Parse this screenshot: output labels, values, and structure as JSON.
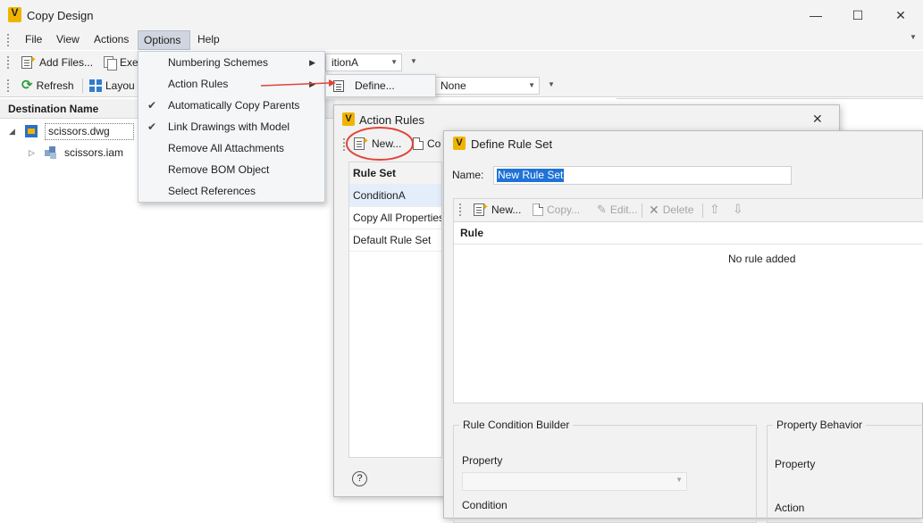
{
  "window": {
    "title": "Copy Design",
    "app_icon_letter": "V",
    "controls": {
      "minimize": "—",
      "maximize": "☐",
      "close": "✕"
    }
  },
  "menubar": {
    "items": [
      "File",
      "View",
      "Actions",
      "Options",
      "Help"
    ],
    "active": "Options"
  },
  "toolbar1": {
    "add_files": "Add Files...",
    "execute_partial": "Exe",
    "combo_value": "itionA"
  },
  "toolbar2": {
    "refresh": "Refresh",
    "layout_partial": "Layou",
    "combo_value": "None"
  },
  "tree": {
    "header": "Destination Name",
    "rows": [
      {
        "label": "scissors.dwg",
        "expanded": true
      },
      {
        "label": "scissors.iam",
        "expanded": false
      }
    ]
  },
  "options_menu": {
    "items": [
      {
        "label": "Numbering Schemes",
        "checked": false,
        "submenu": true
      },
      {
        "label": "Action Rules",
        "checked": false,
        "submenu": true
      },
      {
        "label": "Automatically Copy Parents",
        "checked": true,
        "submenu": false
      },
      {
        "label": "Link Drawings with Model",
        "checked": true,
        "submenu": false
      },
      {
        "label": "Remove All Attachments",
        "checked": false,
        "submenu": false
      },
      {
        "label": "Remove BOM Object",
        "checked": false,
        "submenu": false
      },
      {
        "label": "Select References",
        "checked": false,
        "submenu": false
      }
    ],
    "submenu_item": "Define..."
  },
  "action_rules": {
    "title": "Action Rules",
    "new_button": "New...",
    "copy_partial": "Co",
    "list_header": "Rule Set",
    "rule_sets": [
      "ConditionA",
      "Copy All Properties",
      "Default Rule Set"
    ],
    "selected": "ConditionA",
    "help": "?",
    "close": "✕"
  },
  "define_rule_set": {
    "title": "Define Rule Set",
    "name_label": "Name:",
    "name_value": "New Rule Set",
    "toolbar": {
      "new": "New...",
      "copy": "Copy...",
      "edit": "Edit...",
      "delete": "Delete"
    },
    "rule_header": "Rule",
    "empty_text": "No rule added",
    "condition_builder": {
      "title": "Rule Condition Builder",
      "property": "Property",
      "condition": "Condition"
    },
    "property_behavior": {
      "title": "Property Behavior",
      "property": "Property",
      "action": "Action"
    }
  },
  "colors": {
    "accent": "#2f7dcc",
    "highlight_circle": "#e0443a",
    "selection": "#1e73d6",
    "app_icon": "#f0b400"
  }
}
